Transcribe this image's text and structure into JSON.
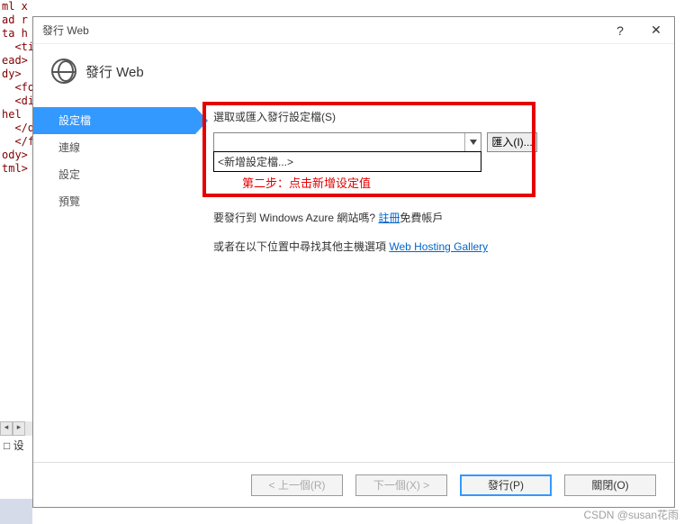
{
  "bg_code": "ml x\nad r\nta h\n  <ti\nead>\ndy>\n  <fo\n  <di\nhel\n  </d\n  </f\nody>\ntml>",
  "bg_tab": "设",
  "dialog": {
    "title": "發行 Web",
    "header": "發行 Web"
  },
  "sidebar": {
    "items": [
      {
        "label": "設定檔",
        "active": true
      },
      {
        "label": "連線",
        "active": false
      },
      {
        "label": "設定",
        "active": false
      },
      {
        "label": "預覽",
        "active": false
      }
    ]
  },
  "main": {
    "select_label": "選取或匯入發行設定檔(S)",
    "combo_value": "",
    "dropdown_option": "<新增設定檔...>",
    "import_button": "匯入(I)...",
    "annotation": "第二步：点击新增设定值",
    "azure_prefix": "要發行到 Windows Azure 網站嗎? ",
    "azure_link": "註冊",
    "azure_suffix": "免費帳戶",
    "gallery_prefix": "或者在以下位置中尋找其他主機選項 ",
    "gallery_link": "Web Hosting Gallery"
  },
  "buttons": {
    "prev": "< 上一個(R)",
    "next": "下一個(X) >",
    "publish": "發行(P)",
    "close": "關閉(O)"
  },
  "titlebar": {
    "help": "?",
    "close": "✕"
  },
  "watermark": "CSDN @susan花雨"
}
